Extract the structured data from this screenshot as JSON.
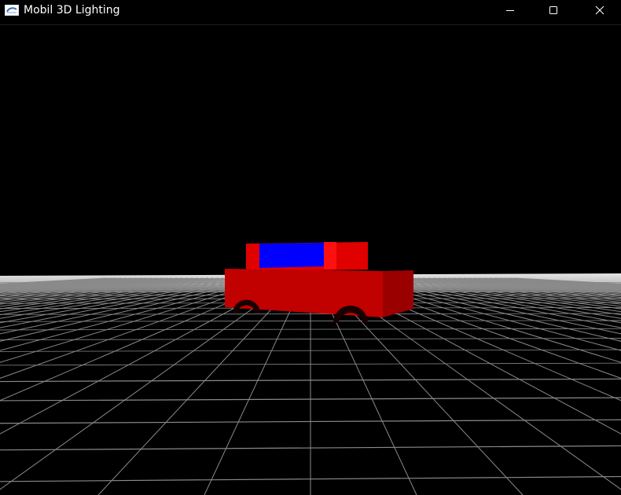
{
  "window": {
    "title": "Mobil 3D Lighting",
    "controls": {
      "minimize": "minimize-icon",
      "maximize": "maximize-icon",
      "close": "close-icon"
    }
  },
  "scene": {
    "background_color": "#000000",
    "floor": {
      "grid_color": "#8a8a8a",
      "horizon_band_color": "#d9d9d9"
    },
    "car": {
      "body_color": "#c10000",
      "body_side_color": "#9b0000",
      "cabin_color": "#e00000",
      "window_color": "#0000ff",
      "wheel_color": "#1a0000"
    }
  }
}
